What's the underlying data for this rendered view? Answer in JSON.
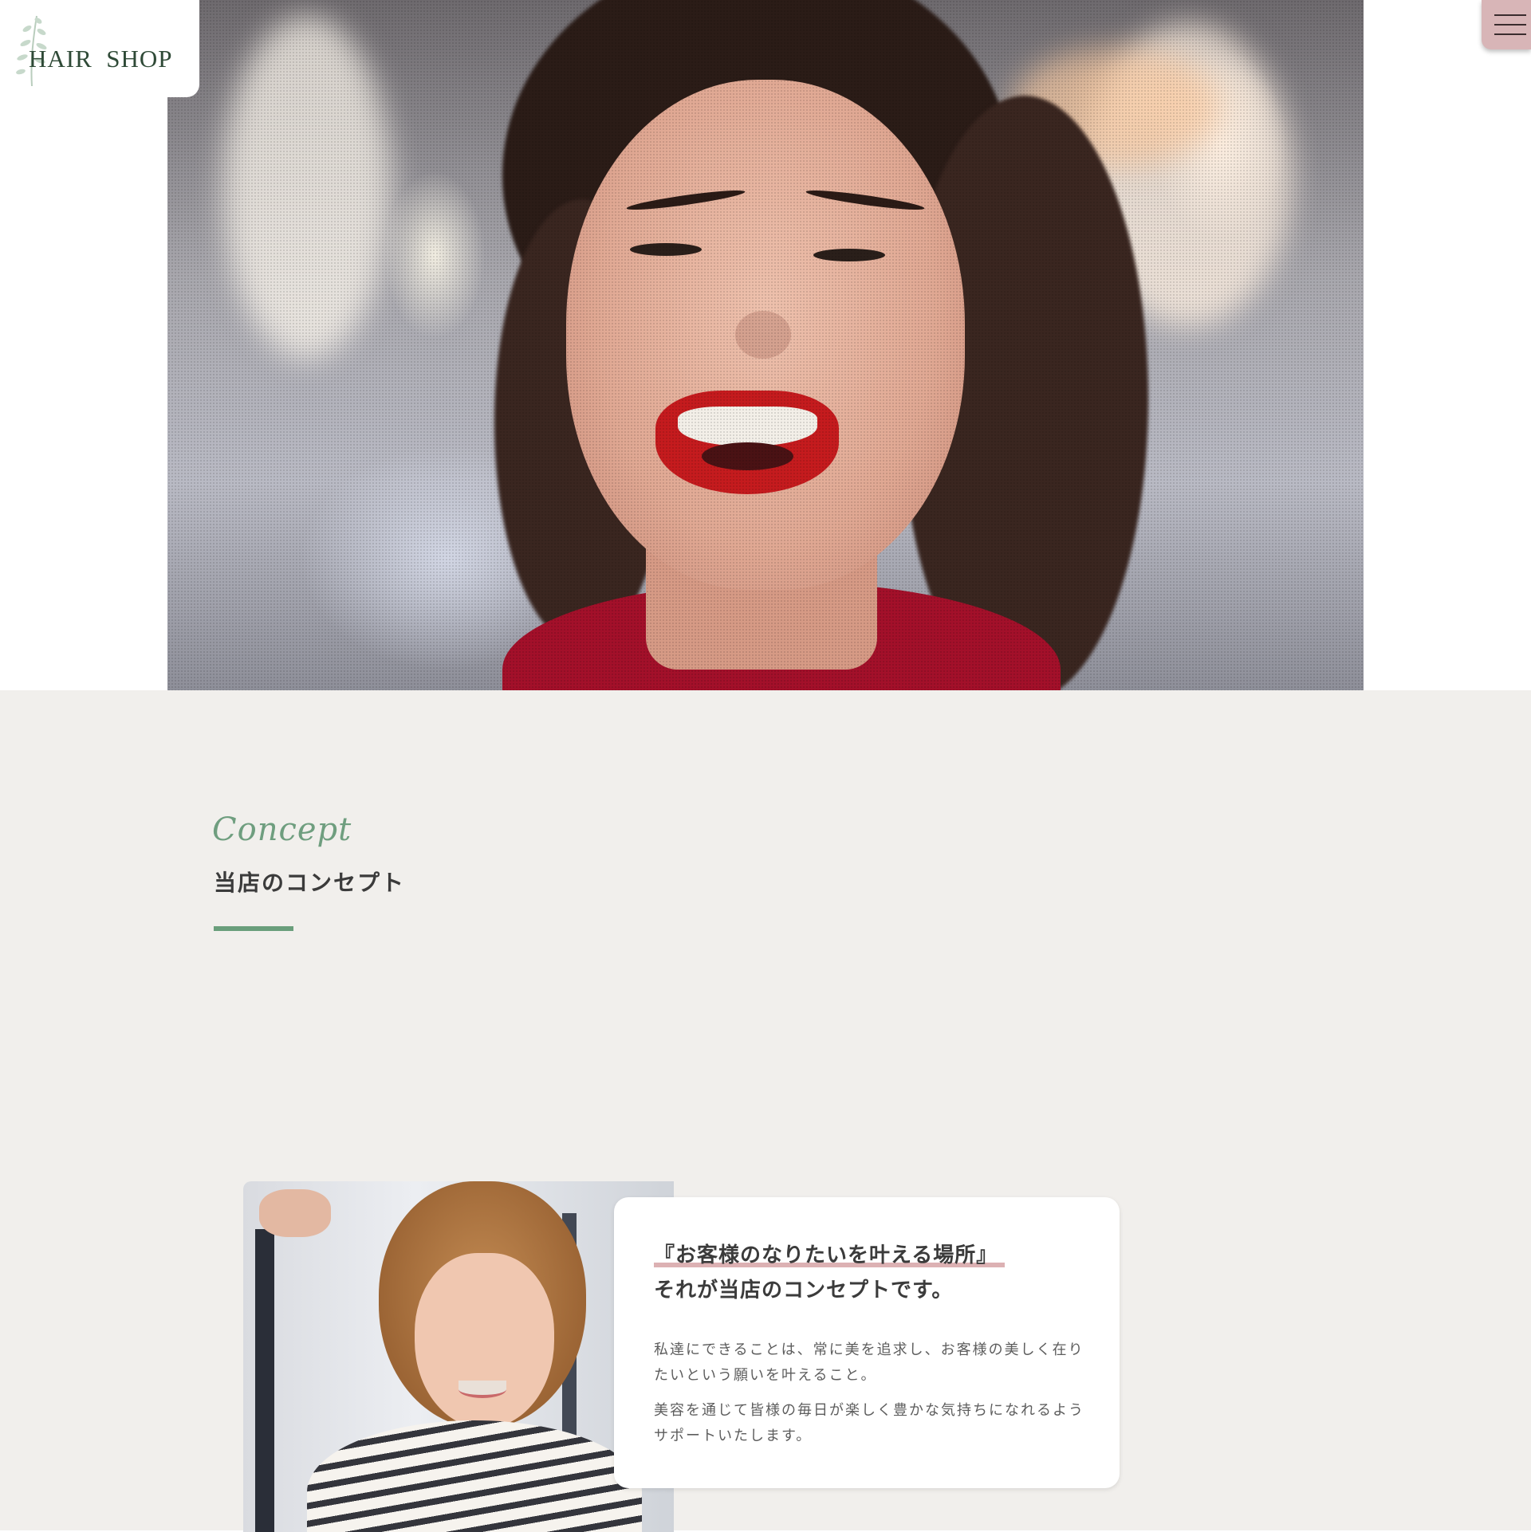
{
  "header": {
    "logo_text": "HAIR  SHOP",
    "logo_leaf_icon": "leaf-sprig-icon",
    "menu_icon": "hamburger-menu-icon"
  },
  "hero": {
    "image": "smiling woman with dark wavy hair and red lipstick"
  },
  "concept": {
    "script_title": "Concept",
    "heading": "当店のコンセプト",
    "lead": "『お客様のなりたいを叶える場所』",
    "lead_sub": "それが当店のコンセプトです。",
    "paragraph_1": "私達にできることは、常に美を追求し、お客様の美しく在りたいという願いを叶えること。",
    "paragraph_2": "美容を通じて皆様の毎日が楽しく豊かな気持ちになれるようサポートいたします。",
    "image": "smiling woman with short brown hair in a salon"
  },
  "colors": {
    "accent_green": "#6a9e7b",
    "accent_pink": "#d8b5b7",
    "section_bg": "#f1efec",
    "text": "#3b3b3b"
  }
}
